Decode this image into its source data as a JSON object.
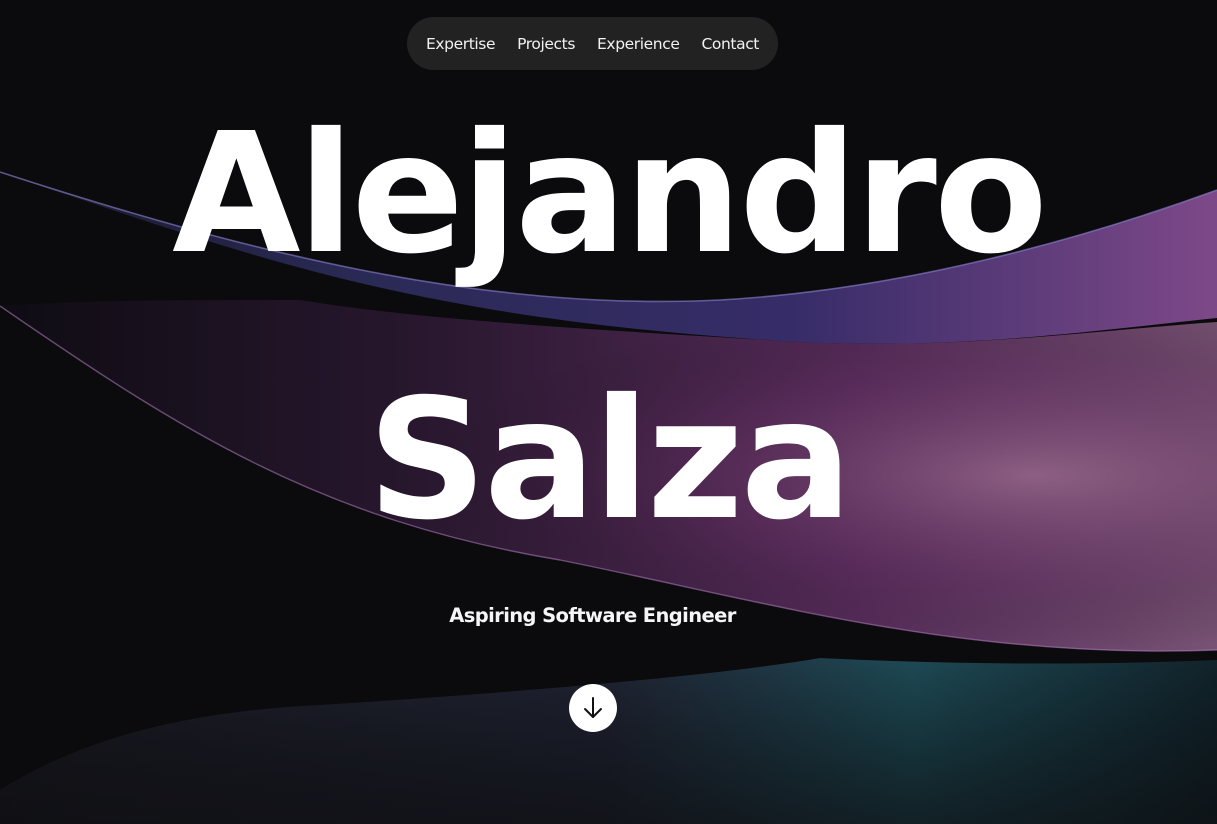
{
  "nav": {
    "items": [
      {
        "label": "Expertise"
      },
      {
        "label": "Projects"
      },
      {
        "label": "Experience"
      },
      {
        "label": "Contact"
      }
    ]
  },
  "hero": {
    "first_name": "Alejandro",
    "last_name": "Salza",
    "subtitle": "Aspiring Software Engineer"
  },
  "scroll_button": {
    "icon": "arrow-down-icon"
  },
  "colors": {
    "background": "#0b0b0d",
    "nav_background": "#222223",
    "text": "#ffffff",
    "wave_purple": "#7a3f86",
    "wave_indigo": "#3d3f8c",
    "wave_teal": "#1f5c6a"
  }
}
